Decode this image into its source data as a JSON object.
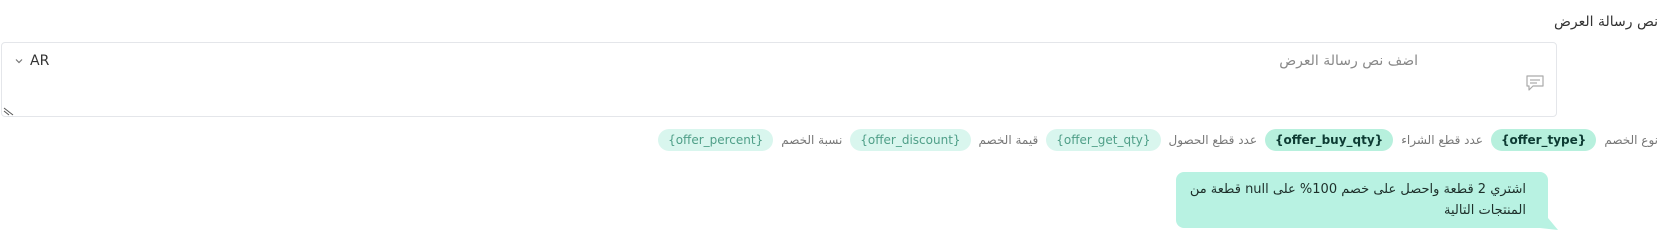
{
  "field": {
    "label": "نص رسالة العرض",
    "placeholder": "اضف نص رسالة العرض",
    "language": "AR",
    "icons": {
      "message": "message-square-icon",
      "chevron": "chevron-down-icon",
      "resize": "resize-handle-icon"
    }
  },
  "variables": [
    {
      "label": "نوع الخصم",
      "token": "{offer_type}",
      "active": true
    },
    {
      "label": "عدد قطع الشراء",
      "token": "{offer_buy_qty}",
      "active": true
    },
    {
      "label": "عدد قطع الحصول",
      "token": "{offer_get_qty}",
      "active": false
    },
    {
      "label": "قيمة الخصم",
      "token": "{offer_discount}",
      "active": false
    },
    {
      "label": "نسبة الخصم",
      "token": "{offer_percent}",
      "active": false
    }
  ],
  "preview": {
    "text": "اشتري 2 قطعة واحصل على خصم 100% على null قطعة من المنتجات التالية"
  },
  "colors": {
    "chip_active_bg": "#b7f0dd",
    "chip_bg": "#d9f6ee",
    "bubble_bg": "#b8f2e2"
  }
}
